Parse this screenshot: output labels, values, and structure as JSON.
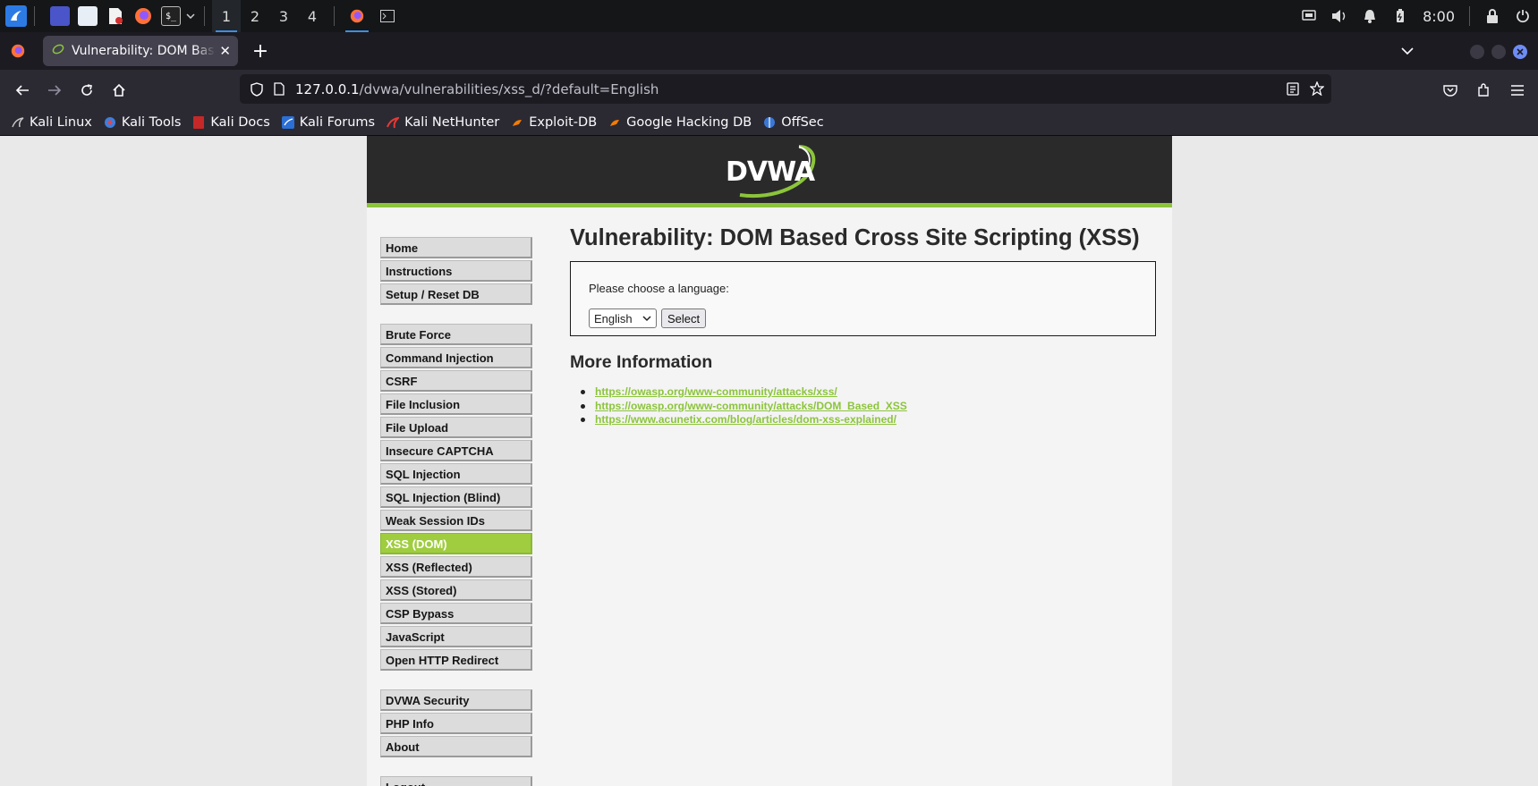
{
  "taskbar": {
    "workspaces": [
      "1",
      "2",
      "3",
      "4"
    ],
    "clock": "8:00"
  },
  "browser": {
    "tab_title": "Vulnerability: DOM Based Cross Site Scripting (XSS)",
    "url_host": "127.0.0.1",
    "url_path": "/dvwa/vulnerabilities/xss_d/?default=English",
    "bookmarks": [
      "Kali Linux",
      "Kali Tools",
      "Kali Docs",
      "Kali Forums",
      "Kali NetHunter",
      "Exploit-DB",
      "Google Hacking DB",
      "OffSec"
    ]
  },
  "page": {
    "logo_text": "DVWA",
    "menu": {
      "group1": [
        "Home",
        "Instructions",
        "Setup / Reset DB"
      ],
      "group2": [
        "Brute Force",
        "Command Injection",
        "CSRF",
        "File Inclusion",
        "File Upload",
        "Insecure CAPTCHA",
        "SQL Injection",
        "SQL Injection (Blind)",
        "Weak Session IDs",
        "XSS (DOM)",
        "XSS (Reflected)",
        "XSS (Stored)",
        "CSP Bypass",
        "JavaScript",
        "Open HTTP Redirect"
      ],
      "group3": [
        "DVWA Security",
        "PHP Info",
        "About"
      ],
      "group4": [
        "Logout"
      ],
      "selected": "XSS (DOM)"
    },
    "title": "Vulnerability: DOM Based Cross Site Scripting (XSS)",
    "prompt": "Please choose a language:",
    "language_selected": "English",
    "select_button": "Select",
    "more_info_heading": "More Information",
    "links": [
      "https://owasp.org/www-community/attacks/xss/",
      "https://owasp.org/www-community/attacks/DOM_Based_XSS",
      "https://www.acunetix.com/blog/articles/dom-xss-explained/"
    ]
  },
  "colors": {
    "accent_green": "#8cc43b",
    "header_dark": "#2a2a2a",
    "browser_chrome": "#2b2a33"
  }
}
